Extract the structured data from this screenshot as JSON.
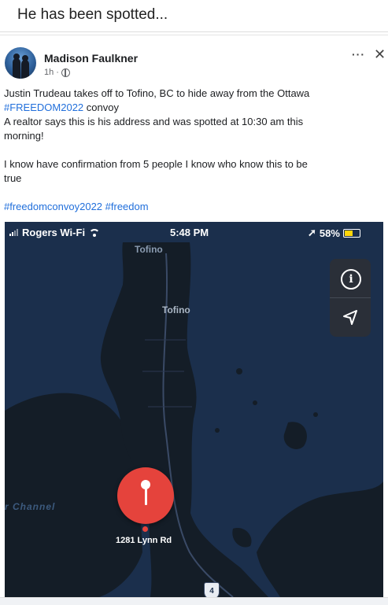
{
  "caption": "He has been spotted...",
  "post": {
    "author": "Madison Faulkner",
    "time": "1h",
    "text_lines": [
      "Justin Trudeau takes off to Tofino, BC to hide away from the Ottawa",
      "convoy",
      " A realtor says this is his address and was spotted at 10:30 am this",
      "morning!",
      "I know have confirmation from 5 people I know who know this to be",
      "true"
    ],
    "hashtag_inline": "#FREEDOM2022",
    "hashtags": "#freedomconvoy2022 #freedom",
    "more_icon": "more-options-icon",
    "close_icon": "close-icon"
  },
  "map": {
    "status": {
      "carrier": "Rogers Wi-Fi",
      "time": "5:48 PM",
      "battery": "58%",
      "battery_level": 0.58,
      "battery_color": "#ffd60a"
    },
    "label_top": "Tofino",
    "label_town": "Tofino",
    "label_water": "r Channel",
    "pin_label": "1281 Lynn Rd",
    "pin_color": "#e5433c",
    "highway_number": "4",
    "water_color": "#1b2f4c",
    "land_color": "#141d27"
  }
}
